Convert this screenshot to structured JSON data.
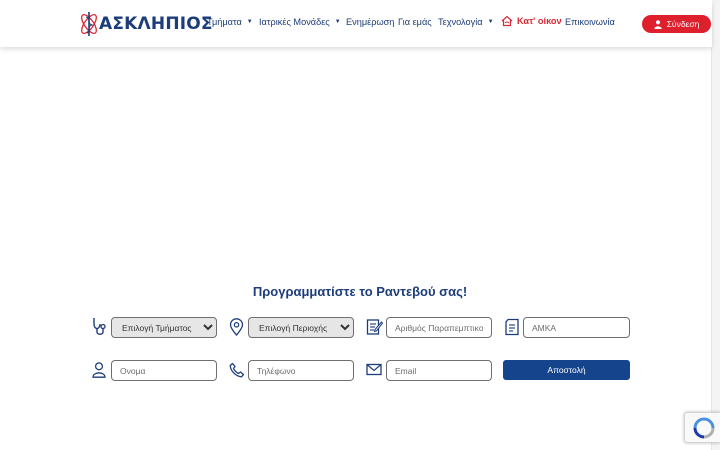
{
  "header": {
    "logo_text": "ΑΣΚΛΗΠΙΟΣ",
    "nav": [
      {
        "label": "Τμήματα",
        "dropdown": true
      },
      {
        "label": "Ιατρικές Μονάδες",
        "dropdown": true
      },
      {
        "label": "Ενημέρωση",
        "dropdown": false
      },
      {
        "label": "Για εμάς",
        "dropdown": false
      },
      {
        "label": "Τεχνολογία",
        "dropdown": true
      },
      {
        "label": "Κατ' οίκον",
        "dropdown": false
      },
      {
        "label": "Επικοινωνία",
        "dropdown": false
      }
    ],
    "login_label": "Σύνδεση"
  },
  "appointment": {
    "title": "Προγραμματίστε το Ραντεβού σας!",
    "department_select": "Επιλογή Τμήματος",
    "region_select": "Επιλογή Περιοχής",
    "referral_placeholder": "Αριθμός Παραπεμπτικού",
    "amka_placeholder": "ΑΜΚΑ",
    "name_placeholder": "Ονομα",
    "phone_placeholder": "Τηλέφωνο",
    "email_placeholder": "Email",
    "submit_label": "Αποστολή"
  },
  "colors": {
    "brand_blue": "#1d3d7a",
    "accent_red": "#de1f2c",
    "button_blue": "#16448c"
  },
  "icons": [
    "logo-icon",
    "caret-down-icon",
    "home-care-icon",
    "user-icon",
    "stethoscope-icon",
    "location-pin-icon",
    "referral-icon",
    "document-icon",
    "person-icon",
    "phone-icon",
    "envelope-icon",
    "recaptcha-icon"
  ]
}
